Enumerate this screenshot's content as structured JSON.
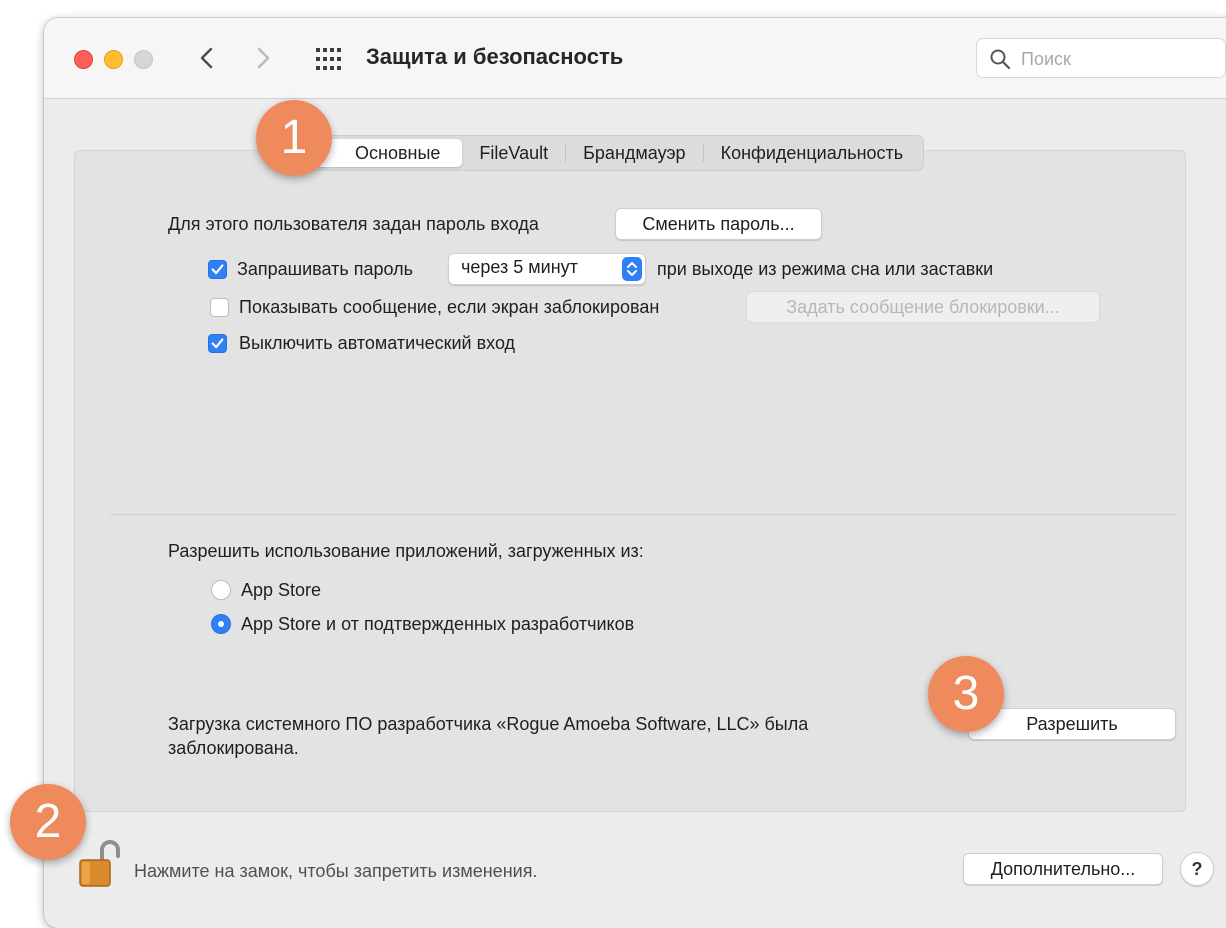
{
  "window": {
    "title": "Защита и безопасность",
    "search_placeholder": "Поиск"
  },
  "tabs": [
    "Основные",
    "FileVault",
    "Брандмауэр",
    "Конфиденциальность"
  ],
  "active_tab": "Основные",
  "general": {
    "login_password_label": "Для этого пользователя задан пароль входа",
    "change_password_button": "Сменить пароль...",
    "require_password_label": "Запрашивать пароль",
    "require_password_checked": true,
    "require_password_delay": "через 5 минут",
    "require_password_suffix": "при выходе из режима сна или заставки",
    "show_message_label": "Показывать сообщение, если экран заблокирован",
    "show_message_checked": false,
    "set_lock_message_button": "Задать сообщение блокировки...",
    "disable_autologin_label": "Выключить автоматический вход",
    "disable_autologin_checked": true
  },
  "apps": {
    "heading": "Разрешить использование приложений, загруженных из:",
    "options": [
      "App Store",
      "App Store и от подтвержденных разработчиков"
    ],
    "selected_index": 1,
    "blocked_line1": "Загрузка системного ПО разработчика «Rogue Amoeba Software, LLC» была",
    "blocked_line2": "заблокирована.",
    "allow_button": "Разрешить"
  },
  "footer": {
    "lock_text": "Нажмите на замок, чтобы запретить изменения.",
    "advanced_button": "Дополнительно...",
    "help_button": "?"
  },
  "annotations": [
    "1",
    "2",
    "3"
  ],
  "colors": {
    "accent": "#2f7ff7",
    "badge": "#ef8a5d",
    "close": "#ff5f57",
    "minimize": "#febc2e"
  }
}
